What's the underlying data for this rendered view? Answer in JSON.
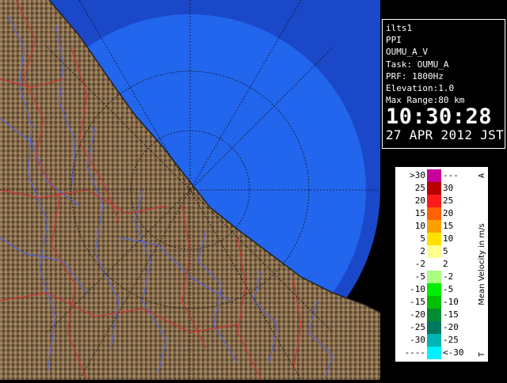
{
  "info": {
    "station": "ilts1",
    "product": "PPI",
    "product_name": "OUMU_A_V",
    "task": "Task: OUMU_A",
    "prf": "PRF: 1800Hz",
    "elevation": "Elevation:1.0",
    "max_range": "Max Range:80 km",
    "time": "10:30:28",
    "date": "27 APR 2012 JST"
  },
  "legend": {
    "title": "Mean Velocity in m/s",
    "top_marker": "A",
    "bottom_marker": "T",
    "rows": [
      {
        "left": ">30",
        "right": "---",
        "color": "#c8009a"
      },
      {
        "left": "25",
        "right": "30",
        "color": "#b80000"
      },
      {
        "left": "20",
        "right": "25",
        "color": "#ff1a1a"
      },
      {
        "left": "15",
        "right": "20",
        "color": "#ff6000"
      },
      {
        "left": "10",
        "right": "15",
        "color": "#ffa000"
      },
      {
        "left": "5",
        "right": "10",
        "color": "#ffe000"
      },
      {
        "left": "2",
        "right": "5",
        "color": "#ffff90"
      },
      {
        "left": "-2",
        "right": "2",
        "color": "#ffffff"
      },
      {
        "left": "-5",
        "right": "-2",
        "color": "#a8ff80"
      },
      {
        "left": "-10",
        "right": "-5",
        "color": "#00ee00"
      },
      {
        "left": "-15",
        "right": "-10",
        "color": "#00c000"
      },
      {
        "left": "-20",
        "right": "-15",
        "color": "#008c30"
      },
      {
        "left": "-25",
        "right": "-20",
        "color": "#007860"
      },
      {
        "left": "-30",
        "right": "-25",
        "color": "#00b4b4"
      },
      {
        "left": "----",
        "right": "<-30",
        "color": "#00f0ff"
      }
    ]
  },
  "colors": {
    "ocean_velocity": "#2266ee",
    "outer_range": "#1a48c8",
    "land": "#8a7050",
    "rivers": "#5566dd",
    "boundaries": "#cc3333"
  }
}
